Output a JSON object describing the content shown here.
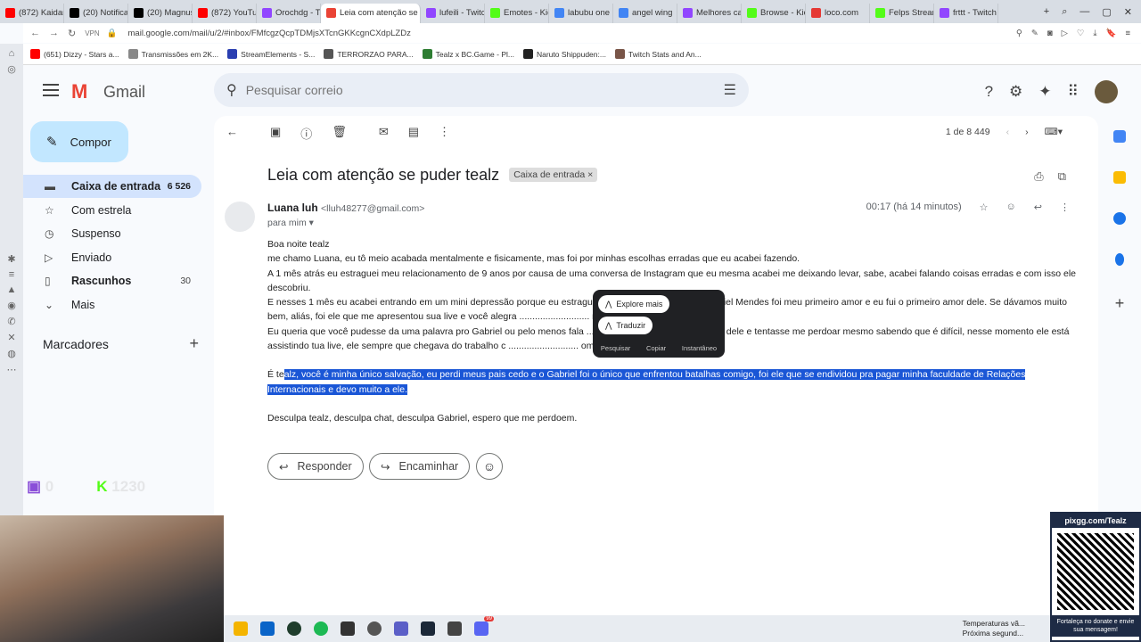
{
  "browser": {
    "tabs": [
      {
        "label": "(872) Kaidan",
        "color": "#ff0000"
      },
      {
        "label": "(20) Notificaç",
        "color": "#000000"
      },
      {
        "label": "(20) Magnus",
        "color": "#000000"
      },
      {
        "label": "(872) YouTub",
        "color": "#ff0000"
      },
      {
        "label": "Orochdg - T",
        "color": "#9146ff"
      },
      {
        "label": "Leia com atenção se p",
        "color": "#ea4335",
        "active": true
      },
      {
        "label": "lufeili - Twitc",
        "color": "#9146ff"
      },
      {
        "label": "Emotes - Kic",
        "color": "#53fc18"
      },
      {
        "label": "labubu one",
        "color": "#4285f4"
      },
      {
        "label": "angel wing",
        "color": "#4285f4"
      },
      {
        "label": "Melhores cas",
        "color": "#9146ff"
      },
      {
        "label": "Browse - Kic",
        "color": "#53fc18"
      },
      {
        "label": "loco.com",
        "color": "#e53935"
      },
      {
        "label": "Felps Stream",
        "color": "#53fc18"
      },
      {
        "label": "frttt - Twitch",
        "color": "#9146ff"
      }
    ],
    "vpn": "VPN",
    "url": "mail.google.com/mail/u/2/#inbox/FMfcgzQcpTDMjsXTcnGKKcgnCXdpLZDz",
    "bookmarks": [
      {
        "label": "(651) Dizzy - Stars a...",
        "color": "#ff0000"
      },
      {
        "label": "Transmissões em 2K...",
        "color": "#888888"
      },
      {
        "label": "StreamElements - S...",
        "color": "#2a3eb1"
      },
      {
        "label": "TERRORZAO PARA...",
        "color": "#555555"
      },
      {
        "label": "Tealz x BC.Game - Pl...",
        "color": "#2e7d32"
      },
      {
        "label": "Naruto Shippuden:...",
        "color": "#222222"
      },
      {
        "label": "Twitch Stats and An...",
        "color": "#795548"
      }
    ]
  },
  "gmail": {
    "logo_text": "Gmail",
    "search_placeholder": "Pesquisar correio",
    "compose_label": "Compor",
    "nav": [
      {
        "label": "Caixa de entrada",
        "count": "6 526",
        "icon": "inbox-icon"
      },
      {
        "label": "Com estrela",
        "count": "",
        "icon": "star-icon"
      },
      {
        "label": "Suspenso",
        "count": "",
        "icon": "clock-icon"
      },
      {
        "label": "Enviado",
        "count": "",
        "icon": "send-icon"
      },
      {
        "label": "Rascunhos",
        "count": "30",
        "icon": "draft-icon"
      },
      {
        "label": "Mais",
        "count": "",
        "icon": "chevron-down-icon"
      }
    ],
    "labels_heading": "Marcadores",
    "pager_text": "1 de 8 449",
    "subject": "Leia com atenção se puder tealz",
    "subject_chip": "Caixa de entrada",
    "sender_name": "Luana luh",
    "sender_email": "<lluh48277@gmail.com>",
    "to_me": "para mim",
    "time": "00:17 (há 14 minutos)",
    "body": {
      "p1": "Boa noite tealz",
      "p2": "me chamo Luana, eu tô meio acabada mentalmente e fisicamente, mas foi por minhas escolhas erradas que eu acabei fazendo.",
      "p3": "A 1 mês atrás eu estraguei meu relacionamento de 9 anos por causa de uma conversa de Instagram que eu mesma acabei me deixando levar, sabe, acabei falando coisas erradas e com isso ele descobriu.",
      "p4": "E nesses 1 mês eu acabei entrando em um mini depressão porque eu estraguei ............................ casa, Gabriel Mendes foi meu primeiro amor e eu fui o primeiro amor dele. Se dávamos muito bem, aliás, foi ele que me apresentou sua live e você alegra ........................... m tealz.",
      "p5": "Eu queria que você pudesse da uma palavra pro Gabriel ou pelo menos fala ............................ pouco a mente dele e tentasse me perdoar mesmo sabendo que é difícil, nesse momento ele está assistindo tua live, ele sempre que chegava do trabalho c ........................... om um sorriso no rosto.",
      "p6_pre": "É te",
      "p6_sel": "alz, você é minha único salvação, eu perdi meus pais cedo e o Gabriel foi o único que enfrentou batalhas comigo, foi ele que se endividou pra pagar minha faculdade de Relações Internacionais e devo muito a ele.",
      "p7": "Desculpa tealz, desculpa chat, desculpa Gabriel, espero que me perdoem."
    },
    "popup": {
      "explore": "Explore mais",
      "translate": "Traduzir",
      "search": "Pesquisar",
      "copy": "Copiar",
      "instant": "Instantâneo"
    },
    "reply_label": "Responder",
    "forward_label": "Encaminhar"
  },
  "stream": {
    "twitch_count": "0",
    "kick_count": "1230",
    "qr_title": "pixgg.com/Tealz",
    "qr_footer": "Fortaleça no donate e envie sua mensagem!",
    "taskbar_badge": "99",
    "weather_line1": "Temperaturas vã...",
    "weather_line2": "Próxima segund..."
  }
}
